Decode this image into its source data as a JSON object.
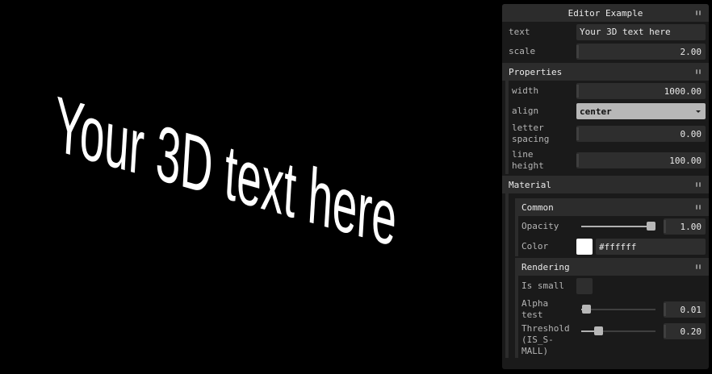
{
  "scene": {
    "text": "Your 3D text here",
    "text_color": "#ffffff",
    "background": "#000000"
  },
  "gui": {
    "title": "Editor Example",
    "text_label": "text",
    "text_value": "Your 3D text here",
    "scale_label": "scale",
    "scale_value": "2.00",
    "properties": {
      "title": "Properties",
      "width_label": "width",
      "width_value": "1000.00",
      "align_label": "align",
      "align_value": "center",
      "letter_label_1": "letter",
      "letter_label_2": "spacing",
      "letter_value": "0.00",
      "line_label_1": "line",
      "line_label_2": "height",
      "line_value": "100.00"
    },
    "material": {
      "title": "Material",
      "common": {
        "title": "Common",
        "opacity_label": "Opacity",
        "opacity_value": "1.00",
        "opacity_fraction": 1.0,
        "color_label": "Color",
        "color_value": "#ffffff"
      },
      "rendering": {
        "title": "Rendering",
        "issmall_label": "Is small",
        "alpha_label_1": "Alpha",
        "alpha_label_2": "test",
        "alpha_value": "0.01",
        "alpha_fraction": 0.01,
        "threshold_label_1": "Threshold",
        "threshold_label_2": "(IS_S-",
        "threshold_label_3": "MALL)",
        "threshold_value": "0.20",
        "threshold_fraction": 0.2
      }
    }
  }
}
